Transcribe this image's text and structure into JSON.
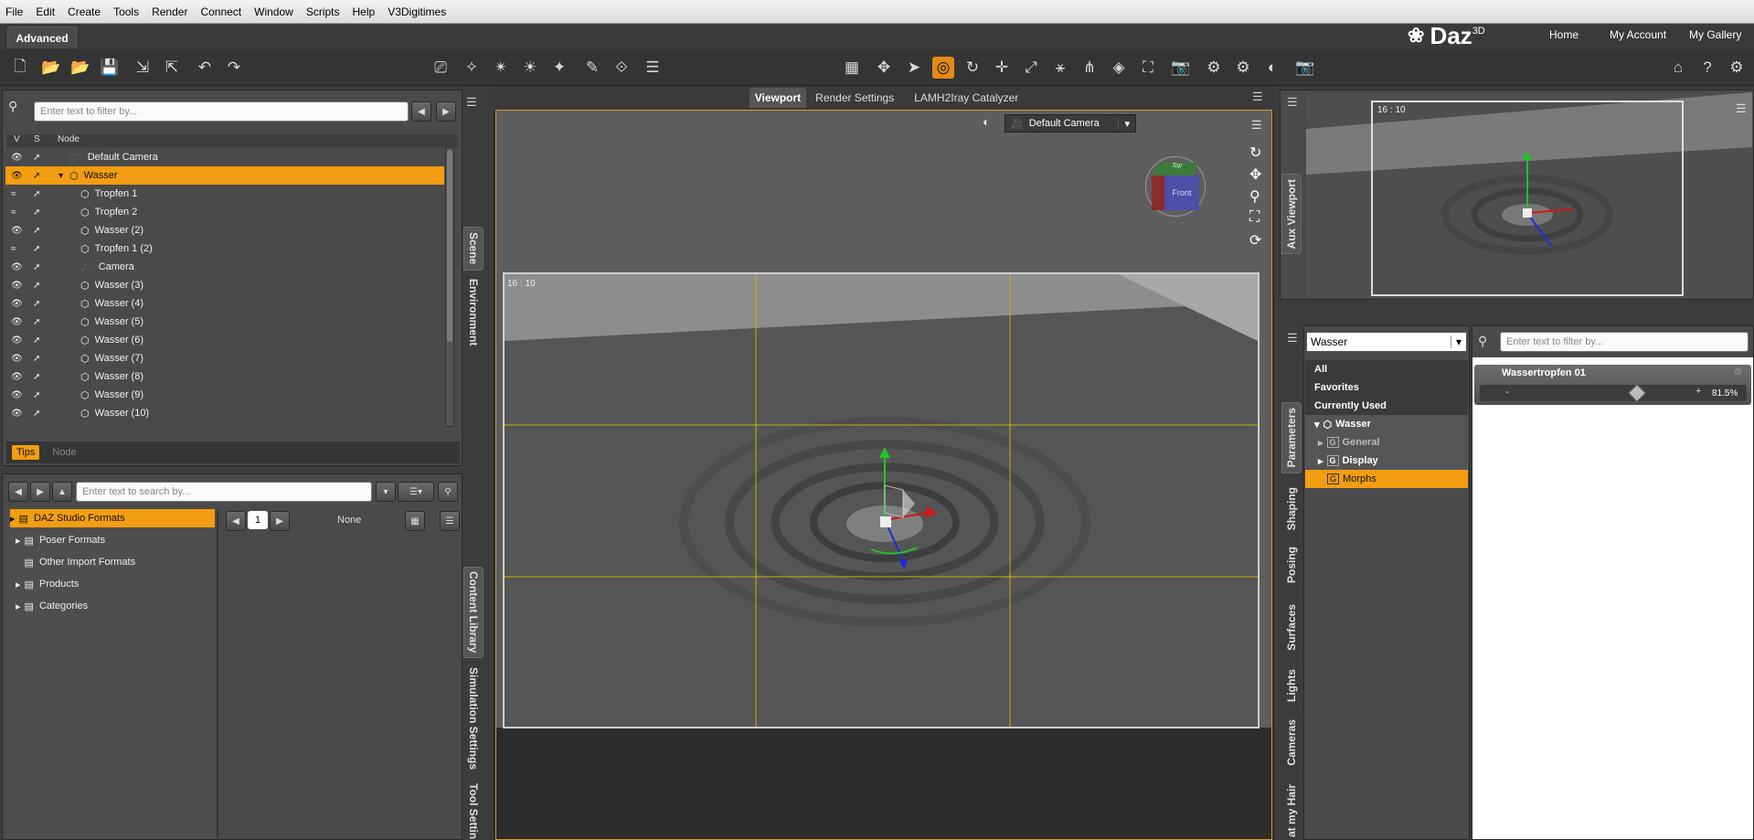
{
  "menu": [
    "File",
    "Edit",
    "Create",
    "Tools",
    "Render",
    "Connect",
    "Window",
    "Scripts",
    "Help",
    "V3Digitimes"
  ],
  "workspace_tab": "Advanced",
  "brand": {
    "name": "Daz",
    "sup": "3D"
  },
  "top_links": [
    "Home",
    "My Account",
    "My Gallery"
  ],
  "scene": {
    "filter_placeholder": "Enter text to filter by...",
    "columns": [
      "V",
      "S",
      "Node"
    ],
    "nodes": [
      {
        "label": "Default Camera",
        "type": "camera",
        "indent": 0,
        "selected": false
      },
      {
        "label": "Wasser",
        "type": "figure",
        "indent": 0,
        "selected": true
      },
      {
        "label": "Tropfen 1",
        "type": "prop",
        "indent": 1,
        "selected": false
      },
      {
        "label": "Tropfen 2",
        "type": "prop",
        "indent": 1,
        "selected": false
      },
      {
        "label": "Wasser (2)",
        "type": "prop",
        "indent": 1,
        "selected": false
      },
      {
        "label": "Tropfen 1 (2)",
        "type": "prop",
        "indent": 1,
        "selected": false
      },
      {
        "label": "Camera",
        "type": "camera",
        "indent": 1,
        "selected": false
      },
      {
        "label": "Wasser (3)",
        "type": "prop",
        "indent": 1,
        "selected": false
      },
      {
        "label": "Wasser (4)",
        "type": "prop",
        "indent": 1,
        "selected": false
      },
      {
        "label": "Wasser (5)",
        "type": "prop",
        "indent": 1,
        "selected": false
      },
      {
        "label": "Wasser (6)",
        "type": "prop",
        "indent": 1,
        "selected": false
      },
      {
        "label": "Wasser (7)",
        "type": "prop",
        "indent": 1,
        "selected": false
      },
      {
        "label": "Wasser (8)",
        "type": "prop",
        "indent": 1,
        "selected": false
      },
      {
        "label": "Wasser (9)",
        "type": "prop",
        "indent": 1,
        "selected": false
      },
      {
        "label": "Wasser (10)",
        "type": "prop",
        "indent": 1,
        "selected": false
      }
    ],
    "footer_tabs": [
      "Tips",
      "Node"
    ],
    "side_tabs": [
      "Scene",
      "Environment"
    ]
  },
  "content": {
    "search_placeholder": "Enter text to search by...",
    "folders": [
      "DAZ Studio Formats",
      "Poser Formats",
      "Other Import Formats",
      "Products",
      "Categories"
    ],
    "page": "1",
    "filter_value": "None",
    "side_tabs": [
      "Content Library",
      "Simulation Settings",
      "Tool Settin"
    ]
  },
  "viewport": {
    "tabs": [
      "Viewport",
      "Render Settings",
      "LAMH2Iray Catalyzer"
    ],
    "camera": "Default Camera",
    "aspect": "16 : 10",
    "cube_labels": {
      "front": "Front",
      "top": "Top"
    }
  },
  "aux": {
    "aspect": "16 : 10",
    "side_tab": "Aux Viewport"
  },
  "parameters": {
    "node": "Wasser",
    "filter_placeholder": "Enter text to filter by...",
    "groups": [
      "All",
      "Favorites",
      "Currently Used"
    ],
    "tree": [
      "Wasser",
      "General",
      "Display",
      "Morphs"
    ],
    "slider": {
      "label": "Wassertropfen 01",
      "value": "81.5%",
      "fraction": 0.815
    },
    "side_tabs": [
      "Parameters",
      "Shaping",
      "Posing",
      "Surfaces",
      "Lights",
      "Cameras",
      "at my Hair"
    ]
  },
  "colors": {
    "accent": "#f29d12",
    "panel": "#4a4a4a",
    "grid": "#c9b400"
  }
}
